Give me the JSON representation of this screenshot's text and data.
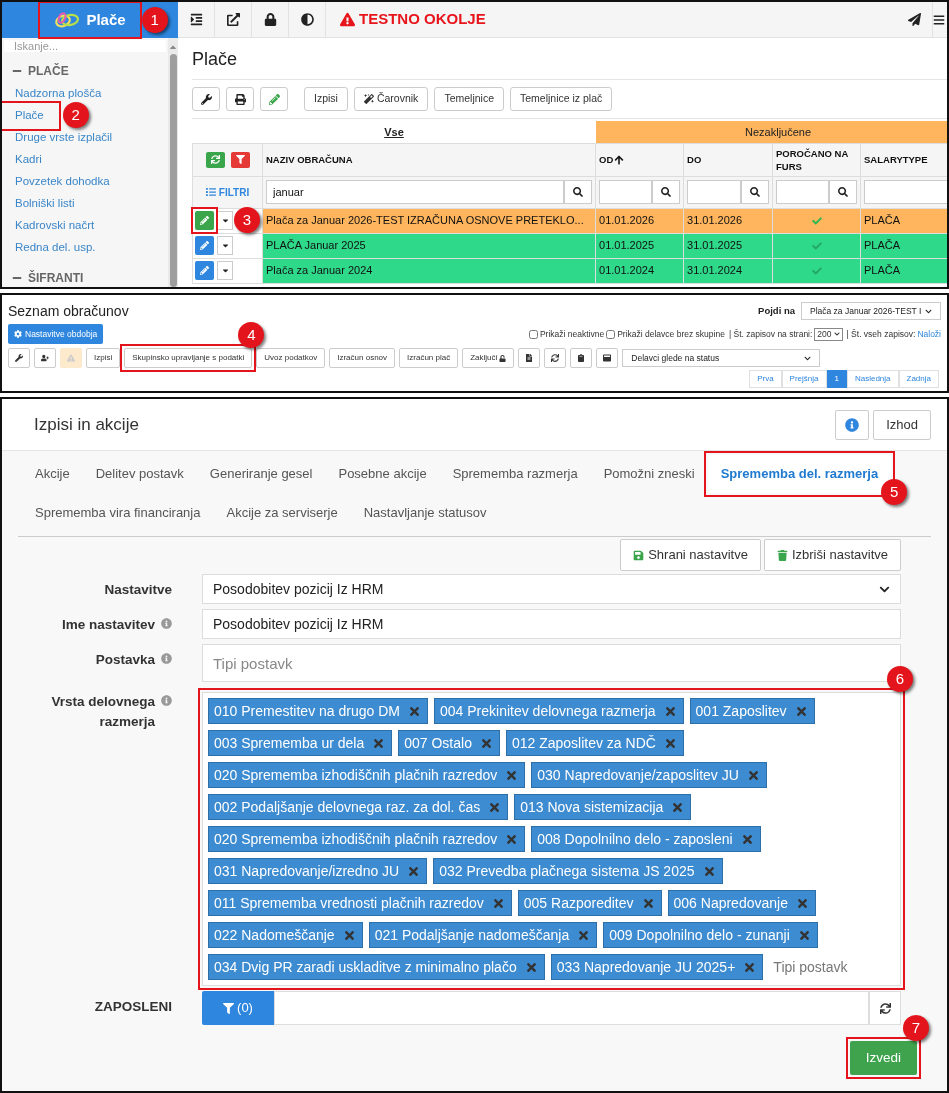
{
  "payroll_panel": {
    "app": {
      "title": "Plače",
      "callout": "1"
    },
    "topbar": {
      "warning": "TESTNO OKOLJE"
    },
    "sidebar": {
      "search": {
        "placeholder": "Iskanje..."
      },
      "sections": [
        {
          "title": "PLAČE",
          "expanded": true,
          "items": [
            {
              "label": "Nadzorna plošča"
            },
            {
              "label": "Plače",
              "callout": "2"
            },
            {
              "label": "Druge vrste izplačil"
            },
            {
              "label": "Kadri"
            },
            {
              "label": "Povzetek dohodka"
            },
            {
              "label": "Bolniški listi"
            },
            {
              "label": "Kadrovski načrt"
            },
            {
              "label": "Redna del. usp."
            }
          ]
        },
        {
          "title": "ŠIFRANTI",
          "expanded": true
        }
      ]
    },
    "title": "Plače",
    "toolbar": [
      {
        "kind": "icon"
      },
      {
        "kind": "icon"
      },
      {
        "kind": "icon"
      },
      {
        "kind": "text",
        "label": "Izpisi"
      },
      {
        "kind": "text",
        "label": "Čarovnik",
        "icon": true
      },
      {
        "kind": "text",
        "label": "Temeljnice"
      },
      {
        "kind": "text",
        "label": "Temeljnice iz plač"
      }
    ],
    "table": {
      "group_headers": [
        {
          "label": "Vse",
          "kind": "all"
        },
        {
          "label": "Nezaključene",
          "kind": "status"
        }
      ],
      "filter_label": "FILTRI",
      "columns": [
        {
          "label": "NAZIV OBRAČUNA",
          "filter_value": "januar",
          "search": true
        },
        {
          "label": "OD",
          "sorted": true,
          "search": true
        },
        {
          "label": "DO",
          "search": true
        },
        {
          "label": "POROČANO NA FURS",
          "search": true
        },
        {
          "label": "SALARYTYPE",
          "search": false
        }
      ],
      "rows": [
        {
          "name": "Plača za Januar 2026-TEST IZRAČUNA OSNOVE PRETEKLO...",
          "from": "01.01.2026",
          "to": "31.01.2026",
          "reported": true,
          "salary_type": "PLAČA",
          "color": "#ffb55e",
          "selected": true,
          "callout": "3"
        },
        {
          "name": "PLAČA Januar 2025",
          "from": "01.01.2025",
          "to": "31.01.2025",
          "reported": true,
          "salary_type": "PLAČA",
          "color": "#2fd98a",
          "selected": false
        },
        {
          "name": "Plača za Januar 2024",
          "from": "01.01.2024",
          "to": "31.01.2024",
          "reported": true,
          "salary_type": "PLAČA",
          "color": "#2fd98a",
          "selected": false
        }
      ]
    }
  },
  "list_panel": {
    "title": "Seznam obračunov",
    "period_button": "Nastavitve obdobja",
    "goto": {
      "label": "Pojdi na",
      "value": "Plača za Januar 2026-TEST I"
    },
    "options": [
      {
        "label": "Prikaži neaktivne",
        "checked": false
      },
      {
        "label": "Prikaži delavce brez skupine",
        "checked": false
      }
    ],
    "page_size": {
      "label": "| Št. zapisov na strani:",
      "value": "200"
    },
    "total": {
      "label": "| Št. vseh zapisov:",
      "link": "Naloži"
    },
    "toolbar": [
      {
        "kind": "icon",
        "disabled": false
      },
      {
        "kind": "icon",
        "disabled": false
      },
      {
        "kind": "icon",
        "disabled": true
      },
      {
        "kind": "text",
        "label": "Izpisi"
      },
      {
        "kind": "text",
        "label": "Skupinsko upravljanje s podatki",
        "callout": "4"
      },
      {
        "kind": "text",
        "label": "Uvoz podatkov"
      },
      {
        "kind": "text",
        "label": "Izračun osnov"
      },
      {
        "kind": "text",
        "label": "Izračun plač"
      },
      {
        "kind": "text",
        "label": "Zaključi",
        "icon": true
      },
      {
        "kind": "icon",
        "disabled": false
      },
      {
        "kind": "icon",
        "disabled": false
      },
      {
        "kind": "icon",
        "disabled": false
      },
      {
        "kind": "icon",
        "disabled": false
      }
    ],
    "status_filter": "Delavci glede na status",
    "pagination": [
      {
        "label": "Prva",
        "selected": false
      },
      {
        "label": "Prejšnja",
        "selected": false
      },
      {
        "label": "1",
        "selected": true
      },
      {
        "label": "Naslednja",
        "selected": false
      },
      {
        "label": "Zadnja",
        "selected": false
      }
    ]
  },
  "actions_panel": {
    "title": "Izpisi in akcije",
    "exit": "Izhod",
    "tabs": [
      {
        "label": "Akcije",
        "selected": false
      },
      {
        "label": "Delitev postavk",
        "selected": false
      },
      {
        "label": "Generiranje gesel",
        "selected": false
      },
      {
        "label": "Posebne akcije",
        "selected": false
      },
      {
        "label": "Sprememba razmerja",
        "selected": false
      },
      {
        "label": "Pomožni zneski",
        "selected": false
      },
      {
        "label": "Sprememba del. razmerja",
        "selected": true,
        "callout": "5"
      },
      {
        "label": "Sprememba vira financiranja",
        "selected": false
      },
      {
        "label": "Akcije za serviserje",
        "selected": false
      },
      {
        "label": "Nastavljanje statusov",
        "selected": false
      }
    ],
    "save": "Shrani nastavitve",
    "delete": "Izbriši nastavitve",
    "fields": [
      {
        "kind": "select",
        "label": "Nastavitve",
        "info": false,
        "value": "Posodobitev pozicij Iz HRM"
      },
      {
        "kind": "text",
        "label": "Ime nastavitev",
        "info": true,
        "value": "Posodobitev pozicij Iz HRM"
      },
      {
        "kind": "text",
        "label": "Postavka",
        "info": true,
        "placeholder": "Tipi postavk"
      },
      {
        "kind": "tags",
        "label": "Vrsta delovnega razmerja",
        "info": true,
        "callout": "6",
        "placeholder": "Tipi postavk",
        "tags": [
          "010 Premestitev na drugo DM",
          "004 Prekinitev delovnega razmerja",
          "001 Zaposlitev",
          "003 Sprememba ur dela",
          "007 Ostalo",
          "012 Zaposlitev za NDČ",
          "020 Sprememba izhodiščnih plačnih razredov",
          "030 Napredovanje/zaposlitev JU",
          "002 Podaljšanje delovnega raz. za dol. čas",
          "013 Nova sistemizacija",
          "020 Sprememba izhodiščnih plačnih razredov",
          "008 Dopolnilno delo - zaposleni",
          "031 Napredovanje/izredno JU",
          "032 Prevedba plačnega sistema JS 2025",
          "011 Sprememba vrednosti plačnih razredov",
          "005 Razporeditev",
          "006 Napredovanje",
          "022 Nadomeščanje",
          "021 Podaljšanje nadomeščanja",
          "009 Dopolnilno delo - zunanji",
          "034 Dvig PR zaradi uskladitve z minimalno plačo",
          "033 Napredovanje JU 2025+"
        ]
      },
      {
        "kind": "employees",
        "label": "ZAPOSLENI",
        "info": false,
        "filter": "(0)"
      }
    ],
    "run": {
      "label": "Izvedi",
      "callout": "7"
    }
  }
}
